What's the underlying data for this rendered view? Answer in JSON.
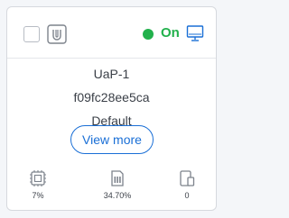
{
  "header": {
    "status_label": "On",
    "status_color": "#22b14c",
    "icons": [
      "checkbox",
      "access-point-icon",
      "monitor-icon"
    ]
  },
  "device": {
    "name": "UaP-1",
    "mac": "f09fc28ee5ca",
    "group": "Default"
  },
  "actions": {
    "view_more_label": "View more"
  },
  "stats": {
    "cpu": {
      "icon": "cpu-icon",
      "value": "7%"
    },
    "memory": {
      "icon": "memory-icon",
      "value": "34.70%"
    },
    "clients": {
      "icon": "clients-device-icon",
      "value": "0"
    }
  },
  "colors": {
    "accent": "#1a6fd6",
    "status_on": "#22b14c",
    "icon_gray": "#7d838c"
  }
}
